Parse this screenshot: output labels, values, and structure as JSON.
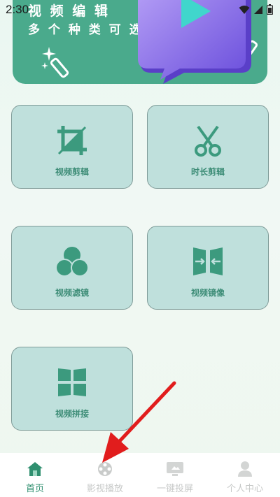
{
  "status_bar": {
    "time": "2:30"
  },
  "banner": {
    "title": "视 频 编 辑",
    "subtitle": "多 个 种 类 可 选"
  },
  "tools": [
    {
      "label": "视频剪辑",
      "icon": "crop-icon"
    },
    {
      "label": "时长剪辑",
      "icon": "scissors-icon"
    },
    {
      "label": "视频滤镜",
      "icon": "filter-circles-icon"
    },
    {
      "label": "视频镜像",
      "icon": "mirror-icon"
    },
    {
      "label": "视频拼接",
      "icon": "grid-tiles-icon"
    }
  ],
  "tabbar": [
    {
      "label": "首页",
      "icon": "home-icon",
      "active": true
    },
    {
      "label": "影视播放",
      "icon": "film-reel-icon",
      "active": false
    },
    {
      "label": "一键投屏",
      "icon": "cast-screen-icon",
      "active": false
    },
    {
      "label": "个人中心",
      "icon": "person-icon",
      "active": false
    }
  ],
  "colors": {
    "accent": "#4aaa8c",
    "card_bg": "#bfe0dc",
    "icon": "#3c9a7e",
    "annotation_arrow": "#e11d1d"
  }
}
